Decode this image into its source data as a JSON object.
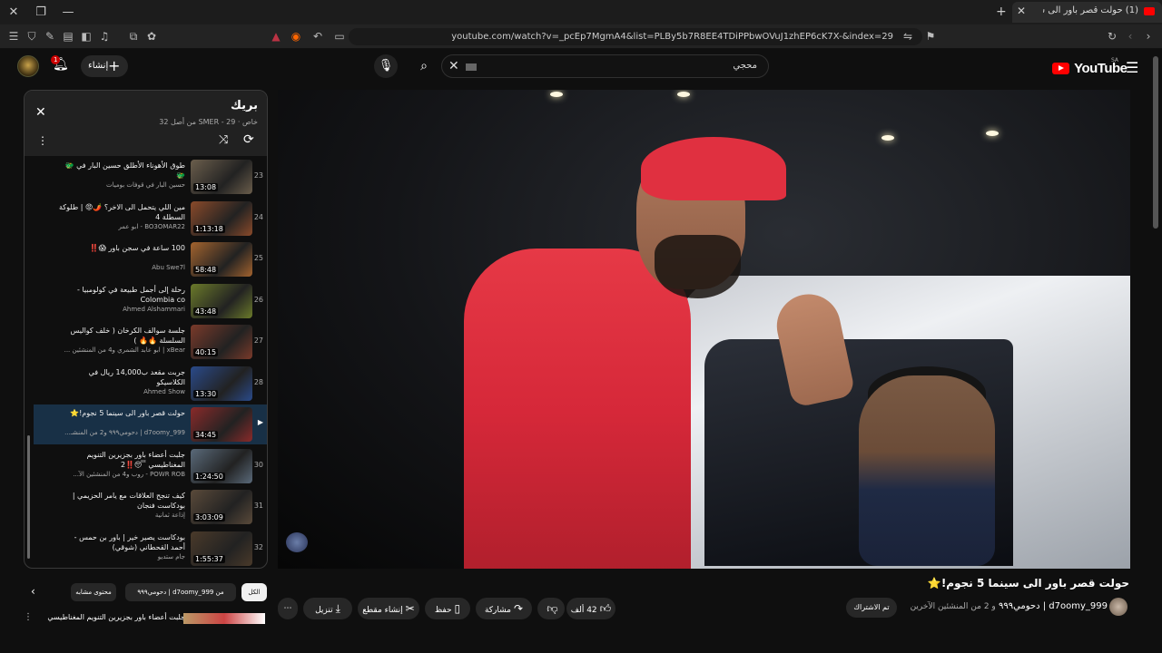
{
  "browser": {
    "tab_title": "(1) حولت قصر باور الى سينما 5",
    "url": "youtube.com/watch?v=_pcEp7MgmA4&list=PLBy5b7R8EE4TDiPPbwOVuJ1zhEP6cK7X-&index=29"
  },
  "header": {
    "logo_text": "YouTube",
    "logo_sup": "SA",
    "search_query": "محجي",
    "create_label": "إنشاء",
    "notification_count": "1"
  },
  "video": {
    "title": "حولت قصر باور الى سينما 5 نجوم!",
    "title_star": "⭐",
    "channel": "d7oomy_999 | دحومي٩٩٩",
    "channel_sub": "و 2 من المنشئين الآخرين",
    "subscribed_label": "تم الاشتراك"
  },
  "actions": {
    "likes": "42 ألف",
    "share": "مشاركة",
    "save": "حفظ",
    "clip": "إنشاء مقطع",
    "download": "تنزيل"
  },
  "playlist": {
    "title": "بريك",
    "subtitle": "خاص · SMER - 29 من أصل 32",
    "items": [
      {
        "num": "23",
        "title": "طوق الأهوناء الأطلق حسين البار في 🐲🐲",
        "by": "حسين البار في قوفات بوميات",
        "dur": "13:08",
        "color": "#6b5e4c"
      },
      {
        "num": "24",
        "title": "مين اللي يتحمل الى الاخر؟ 🌶️😡 | طلوكة السطلة 4",
        "by": "BO3OMAR22 - ابو عمر",
        "dur": "1:13:18",
        "color": "#8a4a2a"
      },
      {
        "num": "25",
        "title": "100 ساعة في سجن باور 😱‼️",
        "by": "Abu Swe7l",
        "dur": "58:48",
        "color": "#a3632e"
      },
      {
        "num": "26",
        "title": "رحلة إلى أجمل طبيعة في كولومبيا - Colombia co",
        "by": "Ahmed Alshammari",
        "dur": "43:48",
        "color": "#6b7a2a"
      },
      {
        "num": "27",
        "title": "جلسة سوالف الكرخان ( خلف كواليس السلسلة 🔥🔥 )",
        "by": "xBear | ابو عابد الشمري و4 من المنشئين ...",
        "dur": "40:15",
        "color": "#7a3a2a"
      },
      {
        "num": "28",
        "title": "جربت مقعد ب14,000 ريال في الكلاسيكو",
        "by": "Ahmed Show",
        "dur": "13:30",
        "color": "#2a4a8a"
      },
      {
        "num": "29",
        "title": "حولت قصر باور الى سينما 5 نجوم!⭐",
        "by": "d7oomy_999 | دحومي٩٩٩ و2 من المنشـ...",
        "dur": "34:45",
        "color": "#8a2a2a",
        "active": true
      },
      {
        "num": "30",
        "title": "جلبت أعضاء باور بجزيرين التنويم المغناطيسي 😴‼️2",
        "by": "POWR ROB - روب و4 من المنشئين الآ...",
        "dur": "1:24:50",
        "color": "#5a6a7a"
      },
      {
        "num": "31",
        "title": "كيف تنجح العلاقات مع يامر الحزيمي | بودكاست فنجان",
        "by": "إذاعة ثمانية",
        "dur": "3:03:09",
        "color": "#5a4a3a"
      },
      {
        "num": "32",
        "title": "بودكاست يصير خير | باور بن حمس - أحمد القحطاني (شوقي)",
        "by": "جام ستديو",
        "dur": "1:55:37",
        "color": "#4a3a2a"
      }
    ]
  },
  "chips": {
    "all": "الكل",
    "from": "من d7oomy_999 | دحومي٩٩٩",
    "similar": "محتوى مشابه"
  },
  "next_up": {
    "title": "جلبت أعضاء باور بجزيرين التنويم المغناطيسي"
  }
}
